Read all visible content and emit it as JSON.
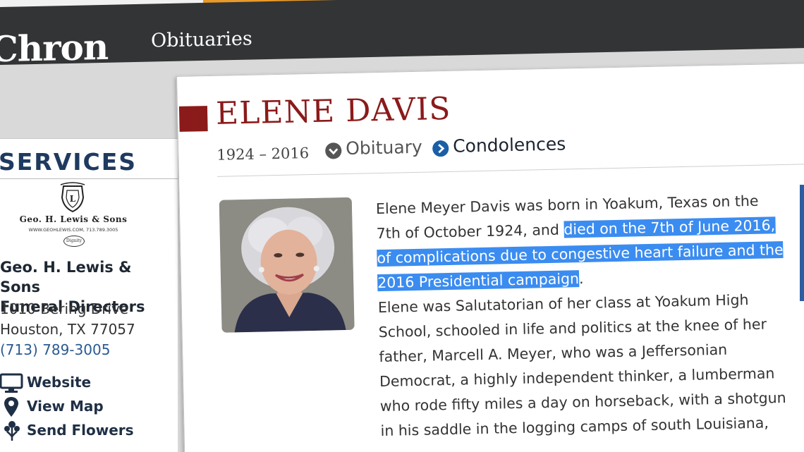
{
  "header": {
    "logo": "Chron",
    "section": "Obituaries"
  },
  "sidebar": {
    "heading": "SERVICES",
    "funeral_home_logo": {
      "name": "Geo. H. Lewis & Sons",
      "line": "WWW.GEOHLEWIS.COM, 713.789.3005",
      "badge": "Dignity"
    },
    "funeral_home_name_line1": "Geo. H. Lewis & Sons",
    "funeral_home_name_line2": "Funeral Directors",
    "address_line1": "1010 Bering Drive",
    "address_line2": "Houston, TX 77057",
    "phone": "(713) 789-3005",
    "links": [
      {
        "label": "Website",
        "icon": "monitor-icon"
      },
      {
        "label": "View Map",
        "icon": "map-pin-icon"
      },
      {
        "label": "Send Flowers",
        "icon": "flowers-icon"
      }
    ]
  },
  "obituary": {
    "name": "ELENE DAVIS",
    "dates": "1924 – 2016",
    "tabs": [
      {
        "label": "Obituary",
        "icon": "chevron-down-circle-icon"
      },
      {
        "label": "Condolences",
        "icon": "chevron-right-circle-icon"
      }
    ],
    "bio_p1_before": "Elene Meyer Davis was born in Yoakum, Texas on the 7th of October 1924, and ",
    "bio_p1_highlight": "died on the 7th of June 2016, of complications due to congestive heart failure and the 2016 Presidential campaign",
    "bio_p1_after": ".",
    "bio_p2": "Elene was Salutatorian of her class at Yoakum High School, schooled in life and politics at the knee of her father, Marcell A. Meyer, who was a Jeffersonian Democrat, a highly independent thinker, a lumberman who rode fifty miles a day on horseback, with a shotgun in his saddle in the logging camps of south Louisiana,"
  },
  "colors": {
    "header_bg": "#333436",
    "name_red": "#8b1a1a",
    "highlight": "#3b8cf0",
    "link_blue": "#1a5fa6",
    "services_navy": "#1f3a5f"
  }
}
